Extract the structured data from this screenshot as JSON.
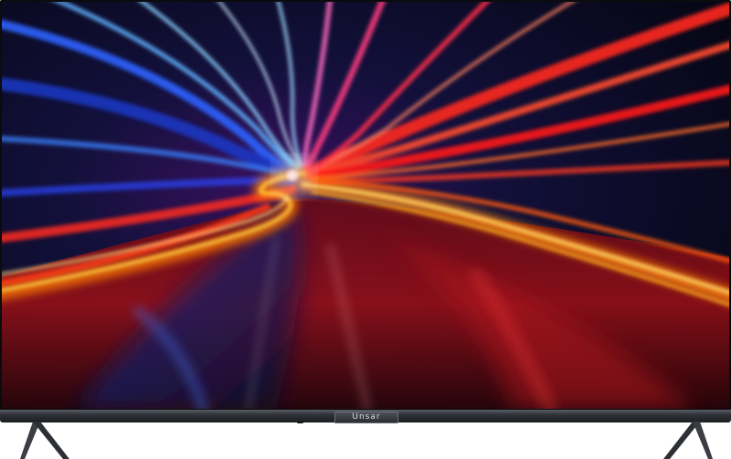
{
  "product": {
    "brand_logo": "Unsar"
  },
  "colors": {
    "bezel": "#0b0b0e",
    "bottom_bar": "#2e3136",
    "stand": "#3a3d42",
    "screen_red": "#e8191b",
    "screen_blue": "#1f4de0",
    "screen_orange": "#ffb020"
  }
}
